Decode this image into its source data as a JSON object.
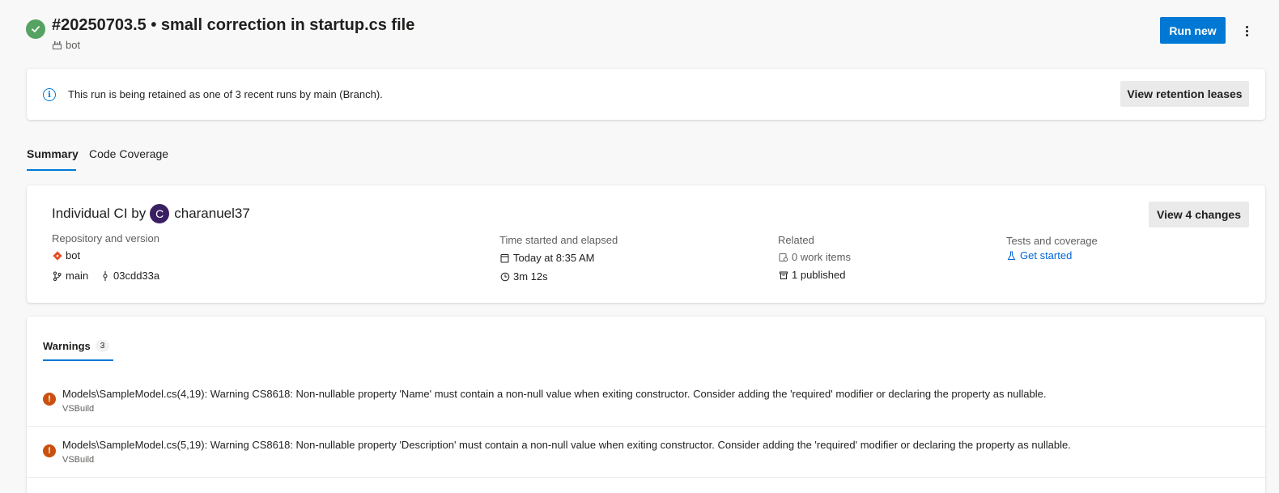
{
  "header": {
    "title": "#20250703.5 • small correction in startup.cs file",
    "pipeline": "bot",
    "run_new_label": "Run new"
  },
  "banner": {
    "message": "This run is being retained as one of 3 recent runs by main (Branch).",
    "button_label": "View retention leases"
  },
  "tabs": [
    {
      "label": "Summary",
      "selected": true
    },
    {
      "label": "Code Coverage",
      "selected": false
    }
  ],
  "summary": {
    "title_prefix": "Individual CI by",
    "avatar_initial": "C",
    "user": "charanuel37",
    "view_changes_label": "View 4 changes",
    "repo": {
      "label": "Repository and version",
      "name": "bot",
      "branch": "main",
      "commit": "03cdd33a"
    },
    "time": {
      "label": "Time started and elapsed",
      "started": "Today at 8:35 AM",
      "elapsed": "3m 12s"
    },
    "related": {
      "label": "Related",
      "work_items": "0 work items",
      "published": "1 published"
    },
    "tests": {
      "label": "Tests and coverage",
      "link": "Get started"
    }
  },
  "warnings": {
    "tab_label": "Warnings",
    "count": "3",
    "items": [
      {
        "message": "Models\\SampleModel.cs(4,19): Warning CS8618: Non-nullable property 'Name' must contain a non-null value when exiting constructor. Consider adding the 'required' modifier or declaring the property as nullable.",
        "source": "VSBuild"
      },
      {
        "message": "Models\\SampleModel.cs(5,19): Warning CS8618: Non-nullable property 'Description' must contain a non-null value when exiting constructor. Consider adding the 'required' modifier or declaring the property as nullable.",
        "source": "VSBuild"
      }
    ]
  },
  "colors": {
    "accent": "#0078d4",
    "success": "#55a362",
    "warning": "#ca5010",
    "avatar": "#3a1f63"
  }
}
